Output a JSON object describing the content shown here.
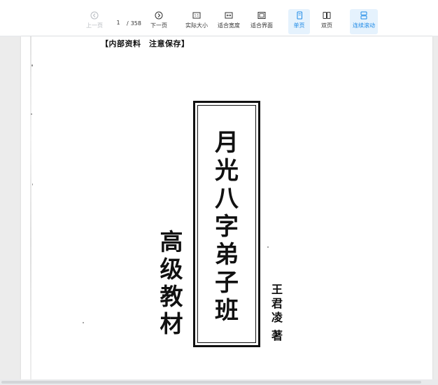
{
  "toolbar": {
    "prev_label": "上一页",
    "next_label": "下一页",
    "current_page": "1",
    "page_separator": "/",
    "total_pages": "358",
    "actual_size_label": "实际大小",
    "fit_width_label": "适合宽度",
    "fit_page_label": "适合界面",
    "single_page_label": "单页",
    "double_page_label": "双页",
    "continuous_scroll_label": "连续滚动",
    "active_color": "#1c89e6",
    "active_bg": "#e5f2fd"
  },
  "document": {
    "header_note": "【内部资料　注意保存】",
    "title_chars": [
      "月",
      "光",
      "八",
      "字",
      "弟",
      "子",
      "班"
    ],
    "subtitle_chars": [
      "高",
      "级",
      "教",
      "材"
    ],
    "author_chars": [
      "王",
      "君",
      "凌"
    ],
    "author_suffix": "著"
  }
}
